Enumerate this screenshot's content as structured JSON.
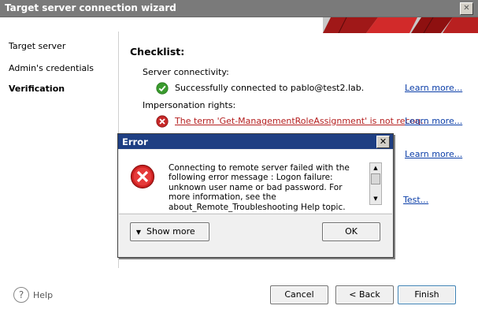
{
  "window": {
    "title": "Target server connection wizard",
    "close": "✕"
  },
  "nav": {
    "items": [
      {
        "label": "Target server"
      },
      {
        "label": "Admin's credentials"
      },
      {
        "label": "Verification"
      }
    ]
  },
  "checklist": {
    "title": "Checklist:",
    "server_connectivity": {
      "heading": "Server connectivity:",
      "status_text": "Successfully connected to pablo@test2.lab.",
      "link": "Learn more..."
    },
    "impersonation": {
      "heading": "Impersonation rights:",
      "status_text": "The term 'Get-ManagementRoleAssignment' is not recog...",
      "link": "Learn more..."
    },
    "third_link": "Learn more...",
    "test_link": "Test..."
  },
  "footer": {
    "help_label": "Help",
    "help_icon_glyph": "?",
    "cancel": "Cancel",
    "back": "< Back",
    "finish": "Finish"
  },
  "error_dialog": {
    "title": "Error",
    "close": "✕",
    "message": "Connecting to remote server failed with the following error message : Logon failure: unknown user name or bad password. For more information, see the about_Remote_Troubleshooting Help topic.",
    "show_more": "Show more",
    "ok": "OK"
  },
  "colors": {
    "titlebar": "#7a7a7a",
    "dialog_titlebar": "#1f3f83",
    "link": "#0b3ea8",
    "error_red": "#c62828",
    "success_green": "#3a9b2e"
  }
}
